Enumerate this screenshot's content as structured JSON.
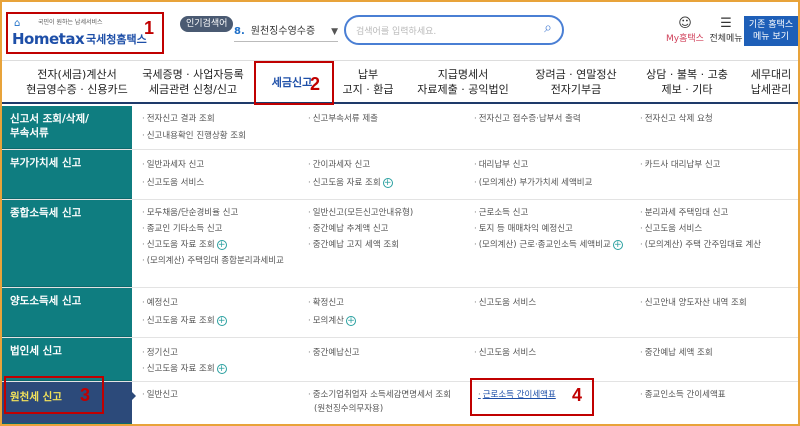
{
  "header": {
    "logo_tagline": "국민이 원하는 납세서비스",
    "logo_text": "Hometax",
    "logo_kr": "국세청홈택스",
    "popular_badge": "인기검색어",
    "popular_num": "8.",
    "popular_term": "원천징수영수증",
    "search_placeholder": "검색어를 입력하세요.",
    "my_hometax": "My홈택스",
    "all_menu": "전체메뉴",
    "legacy_line1": "기존 홈택스",
    "legacy_line2": "메뉴 보기"
  },
  "annotations": {
    "n1": "1",
    "n2": "2",
    "n3": "3",
    "n4": "4"
  },
  "nav": {
    "items": [
      {
        "l1": "전자(세금)계산서",
        "l2": "현금영수증 · 신용카드"
      },
      {
        "l1": "국세증명 · 사업자등록",
        "l2": "세금관련 신청/신고"
      },
      {
        "l1": "세금신고",
        "l2": ""
      },
      {
        "l1": "납부",
        "l2": "고지 · 환급"
      },
      {
        "l1": "지급명세서",
        "l2": "자료제출 · 공익법인"
      },
      {
        "l1": "장려금 · 연말정산",
        "l2": "전자기부금"
      },
      {
        "l1": "상담 · 불복 · 고충",
        "l2": "제보 · 기타"
      },
      {
        "l1": "세무대리",
        "l2": "납세관리"
      }
    ]
  },
  "menu": {
    "rows": [
      {
        "cat_l1": "신고서 조회/삭제/",
        "cat_l2": "부속서류",
        "cells": [
          "전자신고 결과 조회",
          "신고부속서류 제출",
          "전자신고 접수증·납부서 출력",
          "전자신고 삭제 요청",
          "신고내용확인 진행상황 조회"
        ]
      },
      {
        "cat_l1": "부가가치세 신고",
        "cat_l2": "",
        "cells": [
          "일반과세자 신고",
          "간이과세자 신고",
          "대리납부 신고",
          "카드사 대리납부 신고",
          "신고도움 서비스",
          "신고도움 자료 조회",
          "(모의계산) 부가가치세 세액비교"
        ]
      },
      {
        "cat_l1": "종합소득세 신고",
        "cat_l2": "",
        "cells": [
          "모두채움/단순경비율 신고",
          "일반신고(모든신고안내유형)",
          "근로소득 신고",
          "분리과세 주택임대 신고",
          "종교인 기타소득 신고",
          "중간예납 추계액 신고",
          "토지 등 매매차익 예정신고",
          "신고도움 서비스",
          "신고도움 자료 조회",
          "중간예납 고지 세액 조회",
          "(모의계산) 근로·종교인소득 세액비교",
          "(모의계산) 주택 간주임대료 계산",
          "(모의계산) 주택임대 종합분리과세비교"
        ]
      },
      {
        "cat_l1": "양도소득세 신고",
        "cat_l2": "",
        "cells": [
          "예정신고",
          "확정신고",
          "신고도움 서비스",
          "신고안내 양도자산 내역 조회",
          "신고도움 자료 조회",
          "모의계산"
        ]
      },
      {
        "cat_l1": "법인세 신고",
        "cat_l2": "",
        "cells": [
          "정기신고",
          "중간예납신고",
          "신고도움 서비스",
          "중간예납 세액 조회",
          "신고도움 자료 조회"
        ]
      },
      {
        "cat_l1": "원천세 신고",
        "cat_l2": "",
        "cells": [
          "일반신고",
          "중소기업취업자 소득세감면명세서 조회",
          "(원천징수의무자용)",
          "근로소득 간이세액표",
          "종교인소득 간이세액표"
        ]
      }
    ]
  }
}
